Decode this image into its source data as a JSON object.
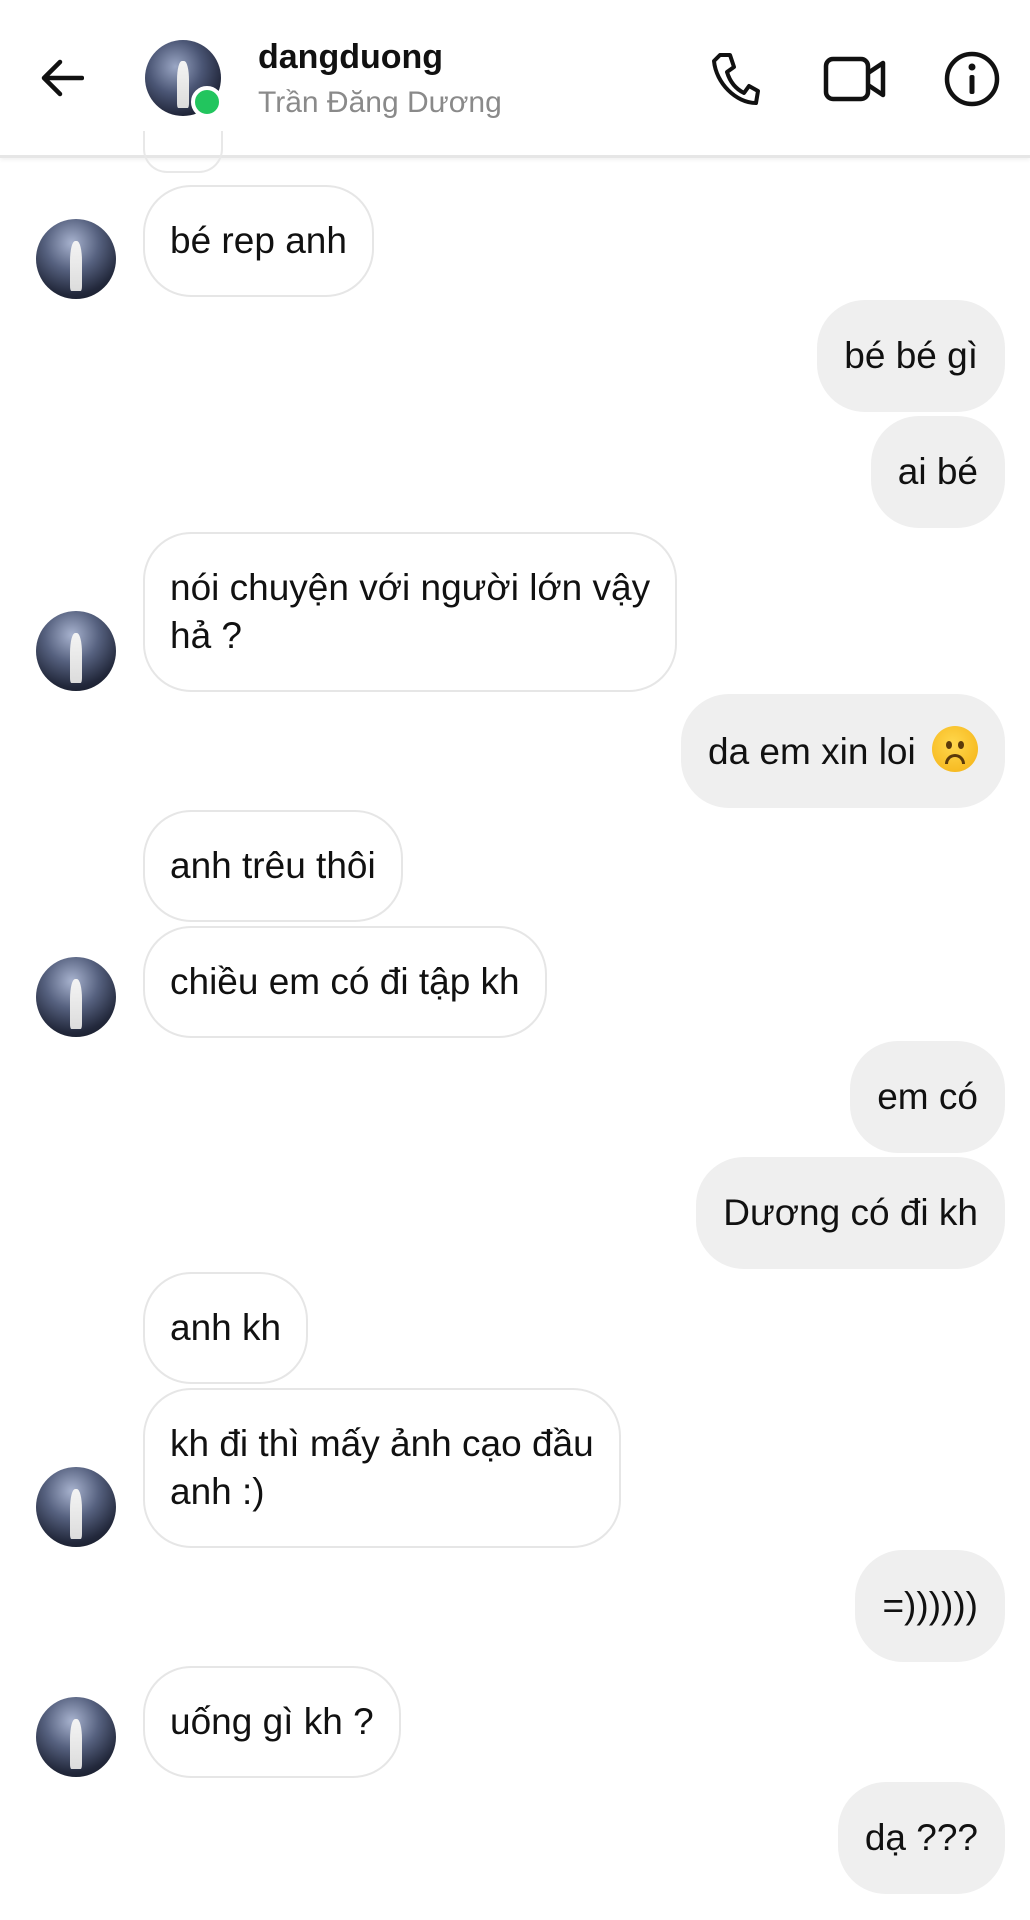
{
  "header": {
    "username": "dangduong",
    "display_name": "Trần Đăng Dương",
    "online": true,
    "icons": [
      "back-arrow-icon",
      "phone-icon",
      "video-camera-icon",
      "info-icon"
    ]
  },
  "messages": [
    {
      "sender": "them",
      "text": "bé rep anh"
    },
    {
      "sender": "me",
      "text": "bé bé gì"
    },
    {
      "sender": "me",
      "text": "ai bé"
    },
    {
      "sender": "them",
      "text": "nói chuyện với người lớn vậy",
      "text2": "hả ?"
    },
    {
      "sender": "me",
      "text": "da em xin loi",
      "emoji": "frowning-face-emoji"
    },
    {
      "sender": "them",
      "text": "anh trêu thôi"
    },
    {
      "sender": "them",
      "text": "chiều em có đi tập kh"
    },
    {
      "sender": "me",
      "text": "em có"
    },
    {
      "sender": "me",
      "text": "Dương có đi kh"
    },
    {
      "sender": "them",
      "text": "anh kh"
    },
    {
      "sender": "them",
      "text": "kh đi thì mấy ảnh cạo đầu",
      "text2": "anh :)"
    },
    {
      "sender": "me",
      "text": "=))))))"
    },
    {
      "sender": "them",
      "text": "uống gì kh ?"
    },
    {
      "sender": "me",
      "text": "dạ ???"
    }
  ],
  "colors": {
    "online_dot": "#22c55e",
    "outgoing_bubble": "#efefef",
    "incoming_border": "#e6e6e6"
  }
}
